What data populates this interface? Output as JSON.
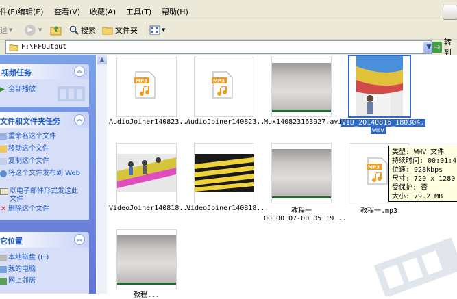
{
  "menu": [
    {
      "label": "件(F)"
    },
    {
      "label": "编辑(E)"
    },
    {
      "label": "查看(V)"
    },
    {
      "label": "收藏(A)"
    },
    {
      "label": "工具(T)"
    },
    {
      "label": "帮助(H)"
    }
  ],
  "toolbar": {
    "back_label": "退",
    "search_label": "搜索",
    "folders_label": "文件夹"
  },
  "address": {
    "path": "F:\\FFOutput",
    "go_label": "转到"
  },
  "sidebar": {
    "video_tasks": {
      "title": "视频任务",
      "items": [
        {
          "label": "全部播放"
        }
      ]
    },
    "file_tasks": {
      "title": "文件和文件夹任务",
      "items": [
        {
          "label": "重命名这个文件"
        },
        {
          "label": "移动这个文件"
        },
        {
          "label": "复制这个文件"
        },
        {
          "label": "将这个文件发布到 Web"
        },
        {
          "label": "以电子邮件形式发送此文件"
        },
        {
          "label": "删除这个文件"
        }
      ]
    },
    "other_places": {
      "title": "它位置",
      "items": [
        {
          "label": "本地磁盘 (F:)"
        },
        {
          "label": "我的电脑"
        },
        {
          "label": "网上邻居"
        }
      ]
    }
  },
  "files": [
    {
      "name": "AudioJoiner140823...",
      "kind": "mp3"
    },
    {
      "name": "AudioJoiner140823...",
      "kind": "mp3"
    },
    {
      "name": "Mux140823163927.avi",
      "kind": "gray"
    },
    {
      "name": "VID_20140816_180304.",
      "name2": "wmv",
      "kind": "beach",
      "selected": true
    },
    {
      "name": "VideoJoiner140818...",
      "kind": "dance"
    },
    {
      "name": "VideoJoiner140818...",
      "kind": "stripes"
    },
    {
      "name": "教程一",
      "name2": "00_00_07-00_05_19...",
      "kind": "gray"
    },
    {
      "name": "教程一.mp3",
      "kind": "mp3"
    },
    {
      "name": "教程...",
      "kind": "gray"
    }
  ],
  "tooltip": {
    "type": "类型: WMV 文件",
    "duration": "持续时间: 00:01:4",
    "bitrate": "位速: 928kbps",
    "size_dims": "尺寸: 720 x 1280",
    "protected": "受保护: 否",
    "filesize": "大小: 79.2 MB"
  },
  "colors": {
    "sidebar_bg": "#6f8ee0",
    "link": "#215dc6",
    "selection": "#316ac5",
    "tooltip_bg": "#ffffe1"
  }
}
